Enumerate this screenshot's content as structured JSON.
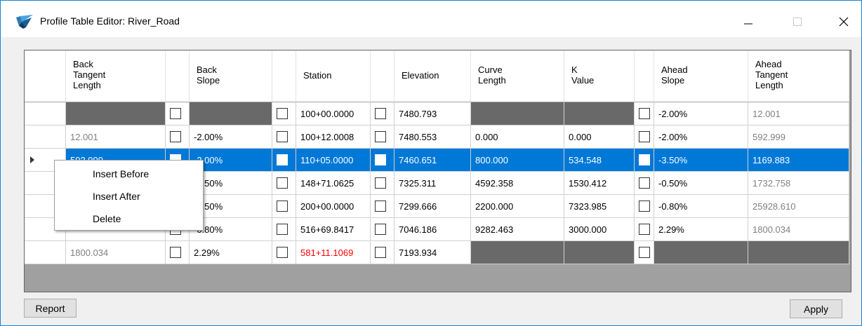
{
  "window": {
    "title": "Profile Table Editor: River_Road"
  },
  "table": {
    "columns": [
      {
        "key": "back_tangent_length",
        "label": "Back\nTangent\nLength"
      },
      {
        "key": "back_slope_check",
        "label": ""
      },
      {
        "key": "back_slope",
        "label": "Back\nSlope"
      },
      {
        "key": "station_check",
        "label": ""
      },
      {
        "key": "station",
        "label": "Station"
      },
      {
        "key": "elevation_check",
        "label": ""
      },
      {
        "key": "elevation",
        "label": "Elevation"
      },
      {
        "key": "curve_length",
        "label": "Curve\nLength"
      },
      {
        "key": "k_value",
        "label": "K\nValue"
      },
      {
        "key": "ahead_slope_check",
        "label": ""
      },
      {
        "key": "ahead_slope",
        "label": "Ahead\nSlope"
      },
      {
        "key": "ahead_tangent_length",
        "label": "Ahead\nTangent\nLength"
      }
    ],
    "rows": [
      {
        "back_tangent_length": "",
        "back_slope": "",
        "station": "100+00.0000",
        "elevation": "7480.793",
        "curve_length": "",
        "k_value": "",
        "ahead_slope": "-2.00%",
        "ahead_tangent_length": "12.001"
      },
      {
        "back_tangent_length": "12.001",
        "back_slope": "-2.00%",
        "station": "100+12.0008",
        "elevation": "7480.553",
        "curve_length": "0.000",
        "k_value": "0.000",
        "ahead_slope": "-2.00%",
        "ahead_tangent_length": "592.999"
      },
      {
        "back_tangent_length": "592.999",
        "back_slope": "-2.00%",
        "station": "110+05.0000",
        "elevation": "7460.651",
        "curve_length": "800.000",
        "k_value": "534.548",
        "ahead_slope": "-3.50%",
        "ahead_tangent_length": "1169.883"
      },
      {
        "back_tangent_length": "",
        "back_slope": "-3.50%",
        "station": "148+71.0625",
        "elevation": "7325.311",
        "curve_length": "4592.358",
        "k_value": "1530.412",
        "ahead_slope": "-0.50%",
        "ahead_tangent_length": "1732.758"
      },
      {
        "back_tangent_length": "",
        "back_slope": "-0.50%",
        "station": "200+00.0000",
        "elevation": "7299.666",
        "curve_length": "2200.000",
        "k_value": "7323.985",
        "ahead_slope": "-0.80%",
        "ahead_tangent_length": "25928.610"
      },
      {
        "back_tangent_length": "",
        "back_slope": "-0.80%",
        "station": "516+69.8417",
        "elevation": "7046.186",
        "curve_length": "9282.463",
        "k_value": "3000.000",
        "ahead_slope": "2.29%",
        "ahead_tangent_length": "1800.034"
      },
      {
        "back_tangent_length": "1800.034",
        "back_slope": "2.29%",
        "station": "581+11.1069",
        "elevation": "7193.934",
        "curve_length": "",
        "k_value": "",
        "ahead_slope": "",
        "ahead_tangent_length": ""
      }
    ],
    "selected_row": 2
  },
  "context_menu": {
    "items": [
      "Insert Before",
      "Insert After",
      "Delete"
    ]
  },
  "buttons": {
    "report": "Report",
    "apply": "Apply"
  },
  "colors": {
    "selection": "#0078d7",
    "disabled_cell": "#696969",
    "warning_text": "#ff0000"
  }
}
